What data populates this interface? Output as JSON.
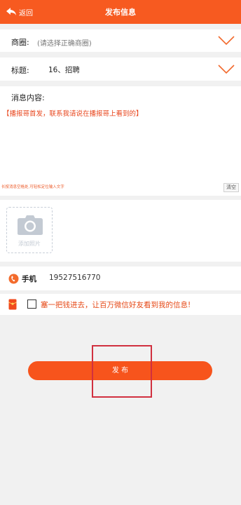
{
  "header": {
    "back_label": "返回",
    "title": "发布信息",
    "color": "#f75a20"
  },
  "shangquan": {
    "label": "商圈:",
    "placeholder": "(请选择正确商圈)"
  },
  "category": {
    "label": "标题:",
    "value": "16、招聘"
  },
  "message": {
    "label": "消息内容:",
    "text": "【播报哥首发，联系我请说在播报哥上看到的】",
    "hint": "长按消息空格处,可轻松定位输入文字",
    "clear_label": "清空"
  },
  "photo": {
    "add_label": "添加照片"
  },
  "phone": {
    "label": "手机",
    "value": "19527516770"
  },
  "promo": {
    "text": "塞一把钱进去，让百万微信好友看到我的信息!",
    "checked": false
  },
  "publish": {
    "label": "发 布",
    "color": "#f7541c"
  },
  "icons": {
    "back": "back-arrow-icon",
    "chevron": "chevron-down-icon",
    "camera": "camera-icon",
    "phone": "phone-icon",
    "redpack": "red-envelope-icon"
  }
}
